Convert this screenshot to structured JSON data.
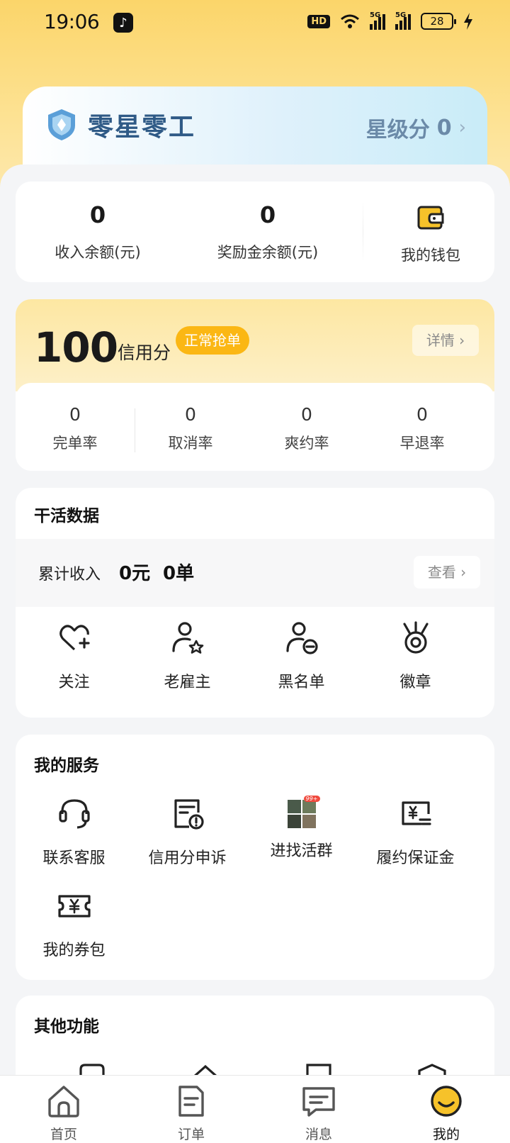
{
  "status_bar": {
    "time": "19:06",
    "hd_label": "HD",
    "signal1_label": "5G",
    "signal2_label": "5G",
    "battery": "28"
  },
  "star_card": {
    "brand": "零星零工",
    "score_label": "星级分",
    "score_value": "0"
  },
  "wallet": {
    "income_value": "0",
    "income_label": "收入余额(元)",
    "bonus_value": "0",
    "bonus_label": "奖励金余额(元)",
    "wallet_label": "我的钱包",
    "accent": "#f6c22a"
  },
  "credit": {
    "score": "100",
    "unit": "信用分",
    "badge": "正常抢单",
    "detail_label": "详情",
    "rates": [
      {
        "value": "0",
        "label": "完单率"
      },
      {
        "value": "0",
        "label": "取消率"
      },
      {
        "value": "0",
        "label": "爽约率"
      },
      {
        "value": "0",
        "label": "早退率"
      }
    ]
  },
  "work": {
    "title": "干活数据",
    "income_label": "累计收入",
    "income_amount": "0元",
    "income_orders": "0单",
    "view_label": "查看",
    "items": [
      {
        "label": "关注",
        "icon": "heart-plus-icon"
      },
      {
        "label": "老雇主",
        "icon": "user-star-icon"
      },
      {
        "label": "黑名单",
        "icon": "user-block-icon"
      },
      {
        "label": "徽章",
        "icon": "medal-icon"
      }
    ]
  },
  "services": {
    "title": "我的服务",
    "items": [
      {
        "label": "联系客服",
        "icon": "headset-icon"
      },
      {
        "label": "信用分申诉",
        "icon": "document-alert-icon"
      },
      {
        "label": "进找活群",
        "icon": "group-thumbnail-icon",
        "badge": "99+"
      },
      {
        "label": "履约保证金",
        "icon": "yen-card-icon"
      },
      {
        "label": "我的券包",
        "icon": "coupon-icon"
      }
    ]
  },
  "other": {
    "title": "其他功能"
  },
  "tabbar": {
    "items": [
      {
        "label": "首页",
        "icon": "home-icon"
      },
      {
        "label": "订单",
        "icon": "orders-icon"
      },
      {
        "label": "消息",
        "icon": "message-icon"
      },
      {
        "label": "我的",
        "icon": "profile-smile-icon",
        "active": true
      }
    ]
  }
}
